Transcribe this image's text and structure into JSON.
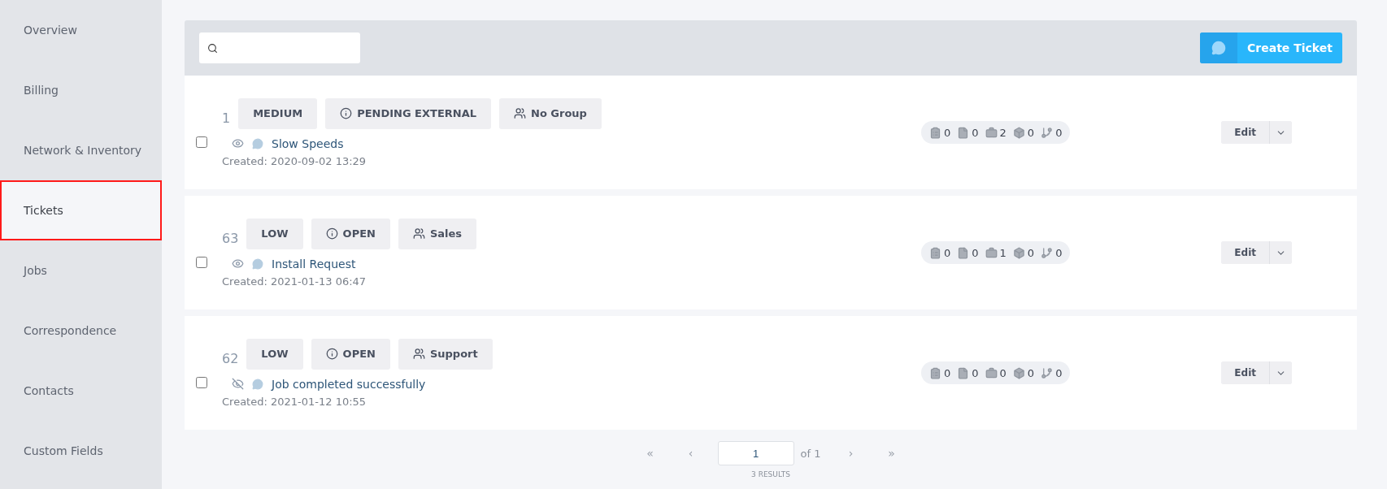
{
  "sidebar": {
    "items": [
      {
        "label": "Overview",
        "selected": false
      },
      {
        "label": "Billing",
        "selected": false
      },
      {
        "label": "Network & Inventory",
        "selected": false
      },
      {
        "label": "Tickets",
        "selected": true
      },
      {
        "label": "Jobs",
        "selected": false
      },
      {
        "label": "Correspondence",
        "selected": false
      },
      {
        "label": "Contacts",
        "selected": false
      },
      {
        "label": "Custom Fields",
        "selected": false
      }
    ]
  },
  "toolbar": {
    "create_button": "Create Ticket"
  },
  "tickets": [
    {
      "number": "1",
      "priority": "MEDIUM",
      "status": "PENDING EXTERNAL",
      "group": "No Group",
      "watched": true,
      "checked": false,
      "title": "Slow Speeds",
      "created": "Created: 2020-09-02 13:29",
      "counts": [
        "0",
        "0",
        "2",
        "0",
        "0"
      ],
      "edit": "Edit"
    },
    {
      "number": "63",
      "priority": "LOW",
      "status": "OPEN",
      "group": "Sales",
      "watched": true,
      "checked": false,
      "title": "Install Request",
      "created": "Created: 2021-01-13 06:47",
      "counts": [
        "0",
        "0",
        "1",
        "0",
        "0"
      ],
      "edit": "Edit"
    },
    {
      "number": "62",
      "priority": "LOW",
      "status": "OPEN",
      "group": "Support",
      "watched": false,
      "checked": false,
      "title": "Job completed successfully",
      "created": "Created: 2021-01-12 10:55",
      "counts": [
        "0",
        "0",
        "0",
        "0",
        "0"
      ],
      "edit": "Edit"
    }
  ],
  "pagination": {
    "first": "«",
    "prev": "‹",
    "page": "1",
    "of": "of 1",
    "next": "›",
    "last": "»",
    "results": "3 RESULTS"
  }
}
